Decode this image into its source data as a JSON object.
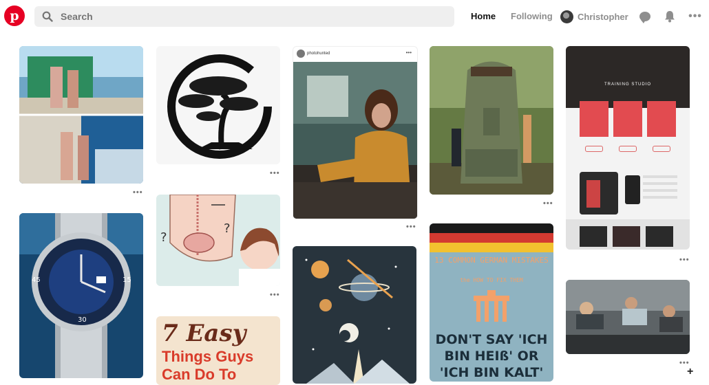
{
  "header": {
    "logo_letter": "p",
    "search_placeholder": "Search",
    "nav": {
      "home": "Home",
      "following": "Following",
      "user": "Christopher"
    },
    "accent": "#e60023"
  },
  "pins": [
    {
      "id": "cruise-photo",
      "icon": "photo"
    },
    {
      "id": "bonsai-tree-circle",
      "icon": "illustration"
    },
    {
      "id": "woman-vinyl-records",
      "icon": "photo",
      "pin_user": "photohunted"
    },
    {
      "id": "green-backpack",
      "icon": "photo"
    },
    {
      "id": "training-studio-website",
      "icon": "website-mockup",
      "title": "TRAINING STUDIO"
    },
    {
      "id": "dive-watch",
      "icon": "photo"
    },
    {
      "id": "posture-illustration",
      "icon": "illustration"
    },
    {
      "id": "space-rocket-poster",
      "icon": "illustration"
    },
    {
      "id": "german-mistakes",
      "icon": "poster",
      "title": "13 COMMON GERMAN MISTAKES",
      "subtitle": "the HOW TO FIX THEM",
      "quote": "DON'T SAY 'ICH BIN HEIß' OR 'ICH BIN KALT'"
    },
    {
      "id": "easy-things",
      "icon": "poster",
      "title": "7 Easy",
      "subtitle": "Things Guys Can Do To"
    },
    {
      "id": "fitness-class",
      "icon": "photo"
    }
  ],
  "more_label": "•••",
  "add_label": "+"
}
